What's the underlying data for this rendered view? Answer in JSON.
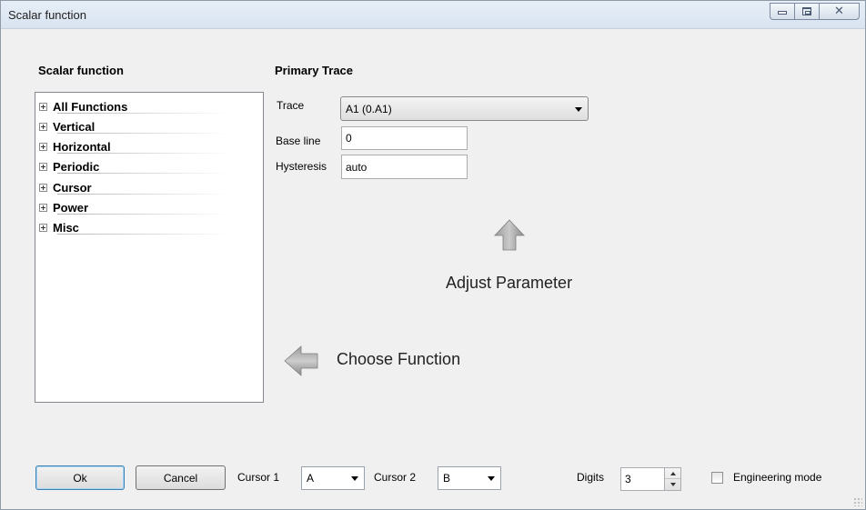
{
  "window": {
    "title": "Scalar function"
  },
  "left_panel": {
    "title": "Scalar function",
    "tree_items": [
      {
        "label": "All Functions"
      },
      {
        "label": "Vertical"
      },
      {
        "label": "Horizontal"
      },
      {
        "label": "Periodic"
      },
      {
        "label": "Cursor"
      },
      {
        "label": "Power"
      },
      {
        "label": "Misc"
      }
    ]
  },
  "primary_trace": {
    "title": "Primary Trace",
    "trace_label": "Trace",
    "trace_value": "A1 (0.A1)",
    "baseline_label": "Base line",
    "baseline_value": "0",
    "hysteresis_label": "Hysteresis",
    "hysteresis_value": "auto"
  },
  "hints": {
    "adjust_parameter": "Adjust Parameter",
    "choose_function": "Choose Function"
  },
  "footer": {
    "ok_label": "Ok",
    "cancel_label": "Cancel",
    "cursor1_label": "Cursor 1",
    "cursor1_value": "A",
    "cursor2_label": "Cursor 2",
    "cursor2_value": "B",
    "digits_label": "Digits",
    "digits_value": "3",
    "engineering_label": "Engineering mode",
    "engineering_checked": false
  },
  "icons": {
    "minimize": "minimize-icon",
    "maximize": "maximize-icon",
    "close": "close-icon",
    "up_arrow": "arrow-up-icon",
    "left_arrow": "arrow-left-icon"
  }
}
